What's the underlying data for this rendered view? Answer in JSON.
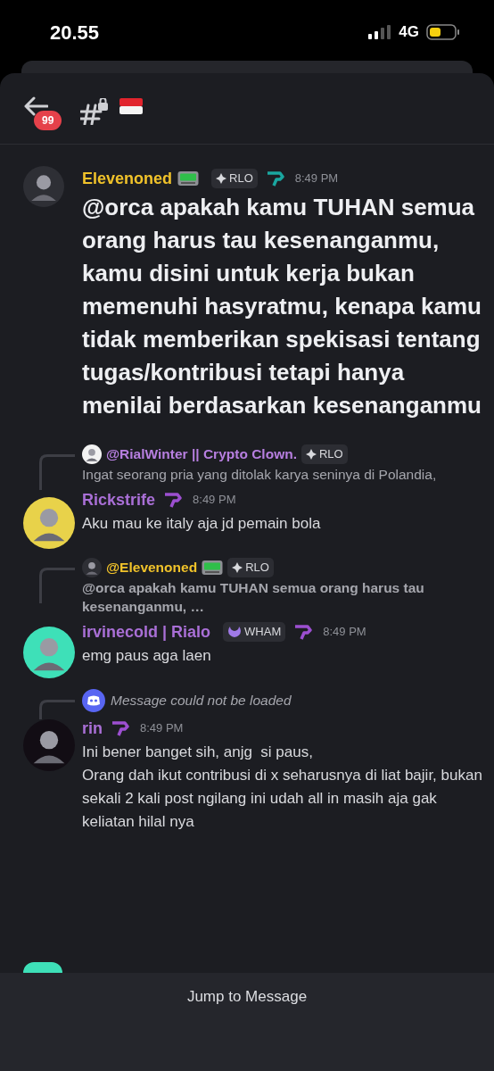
{
  "status_bar": {
    "time": "20.55",
    "network": "4G"
  },
  "header": {
    "unread_badge": "99"
  },
  "messages": [
    {
      "author": "Elevenoned",
      "color": "#f0c22a",
      "avatar": {
        "color": "#2e2f35"
      },
      "pager": true,
      "tag": {
        "kind": "rlo",
        "label": "RLO"
      },
      "role": {
        "color": "#1aa6a0"
      },
      "time": "8:49 PM",
      "large": true,
      "text": "@orca apakah kamu TUHAN semua orang harus tau kesenanganmu, kamu disini untuk kerja bukan memenuhi hasyratmu, kenapa kamu tidak memberikan spekisasi tentang tugas/kontribusi tetapi hanya menilai berdasarkan kesenanganmu"
    },
    {
      "reply": {
        "kind": "quote",
        "author": "@RialWinter || Crypto Clown.",
        "color": "#b77fe0",
        "avatar": {
          "color": "#f2f2f2"
        },
        "pager": false,
        "tag": {
          "kind": "rlo",
          "label": "RLO"
        },
        "bold": false,
        "text": "Ingat seorang pria yang ditolak karya seninya di Polandia,"
      },
      "author": "Rickstrife",
      "color": "#a96fd6",
      "avatar": {
        "color": "#e8d24a"
      },
      "pager": false,
      "role": {
        "color": "#9c4fd0"
      },
      "time": "8:49 PM",
      "large": false,
      "text": "Aku mau ke italy aja jd pemain bola"
    },
    {
      "reply": {
        "kind": "quote",
        "author": "@Elevenoned",
        "color": "#f0c22a",
        "avatar": {
          "color": "#2e2f35"
        },
        "pager": true,
        "tag": {
          "kind": "rlo",
          "label": "RLO"
        },
        "bold": true,
        "text": "@orca apakah kamu TUHAN semua orang harus tau kesenanganmu, …"
      },
      "author": "irvinecold | Rialo",
      "color": "#a96fd6",
      "avatar": {
        "color": "#3ee0b8"
      },
      "pager": false,
      "tag": {
        "kind": "wham",
        "label": "WHAM"
      },
      "role": {
        "color": "#9c4fd0"
      },
      "time": "8:49 PM",
      "large": false,
      "text": "emg paus aga laen"
    },
    {
      "reply": {
        "kind": "missing",
        "text": "Message could not be loaded"
      },
      "author": "rin",
      "color": "#a96fd6",
      "avatar": {
        "color": "#120d14"
      },
      "pager": false,
      "role": {
        "color": "#9c4fd0"
      },
      "time": "8:49 PM",
      "large": false,
      "text": "Ini bener banget sih, anjg  si paus,\nOrang dah ikut contribusi di x seharusnya di liat bajir, bukan sekali 2 kali post ngilang ini udah all in masih aja gak keliatan hilal nya"
    }
  ],
  "bottom_sheet": {
    "button": "Jump to Message"
  }
}
